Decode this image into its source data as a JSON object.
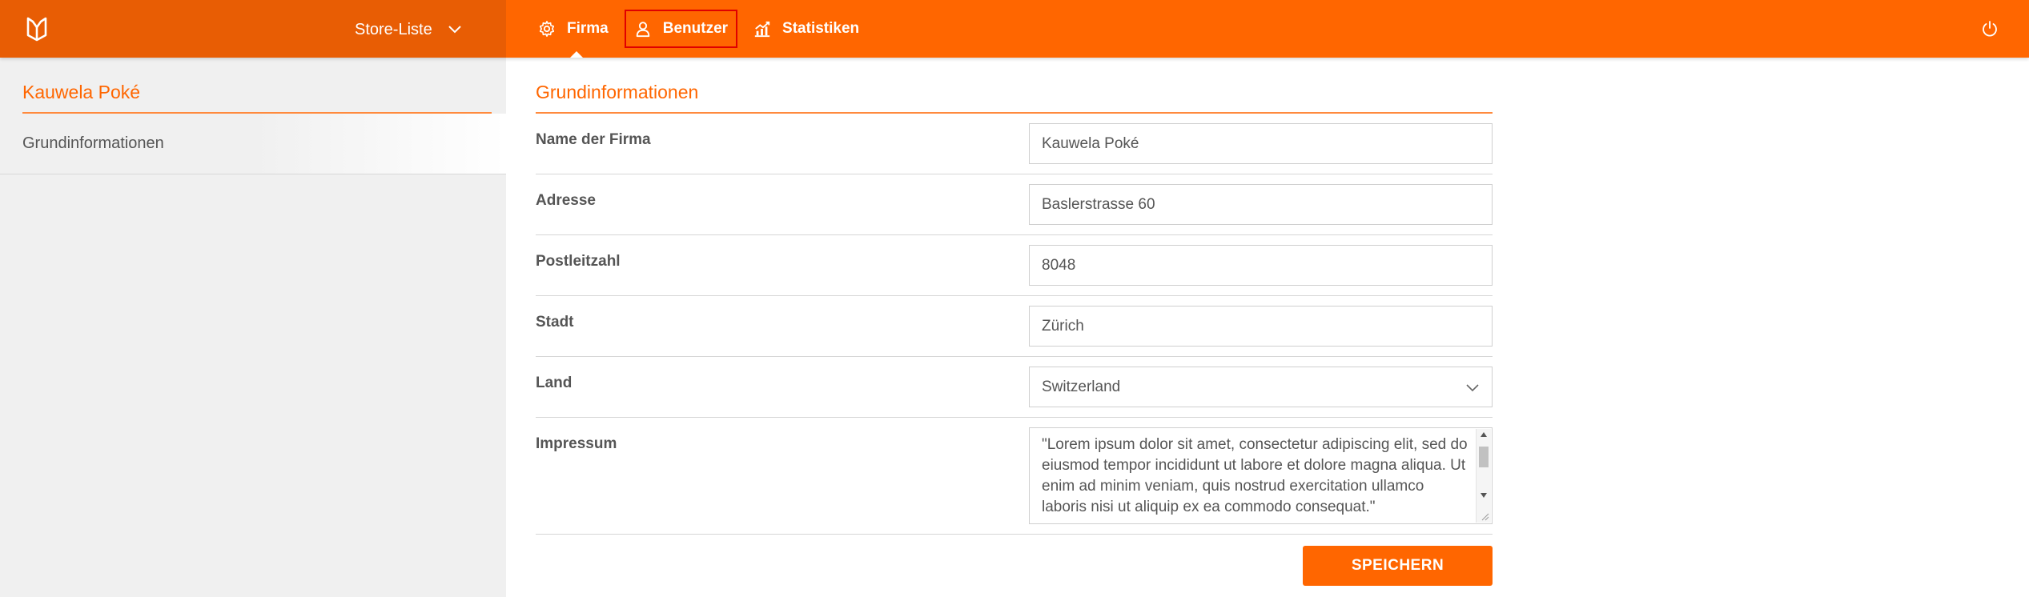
{
  "header": {
    "store_switcher_label": "Store-Liste",
    "nav": [
      {
        "label": "Firma",
        "icon": "gear-icon",
        "active": true
      },
      {
        "label": "Benutzer",
        "icon": "user-icon",
        "active": false
      },
      {
        "label": "Statistiken",
        "icon": "chart-icon",
        "active": false
      }
    ],
    "logout_icon": "power-icon"
  },
  "sidebar": {
    "company_name": "Kauwela Poké",
    "items": [
      {
        "label": "Grundinformationen"
      }
    ]
  },
  "main": {
    "section_title": "Grundinformationen",
    "fields": {
      "company_name": {
        "label": "Name der Firma",
        "value": "Kauwela Poké"
      },
      "address": {
        "label": "Adresse",
        "value": "Baslerstrasse 60"
      },
      "postal_code": {
        "label": "Postleitzahl",
        "value": "8048"
      },
      "city": {
        "label": "Stadt",
        "value": "Zürich"
      },
      "country": {
        "label": "Land",
        "value": "Switzerland"
      },
      "imprint": {
        "label": "Impressum",
        "value": "\"Lorem ipsum dolor sit amet, consectetur adipiscing elit, sed do eiusmod tempor incididunt ut labore et dolore magna aliqua. Ut enim ad minim veniam, quis nostrud exercitation ullamco laboris nisi ut aliquip ex ea commodo consequat.\""
      }
    },
    "save_label": "SPEICHERN"
  },
  "colors": {
    "brand": "#ff6600",
    "brand_dark": "#e85d04",
    "sidebar_bg": "#f0f0f0"
  }
}
